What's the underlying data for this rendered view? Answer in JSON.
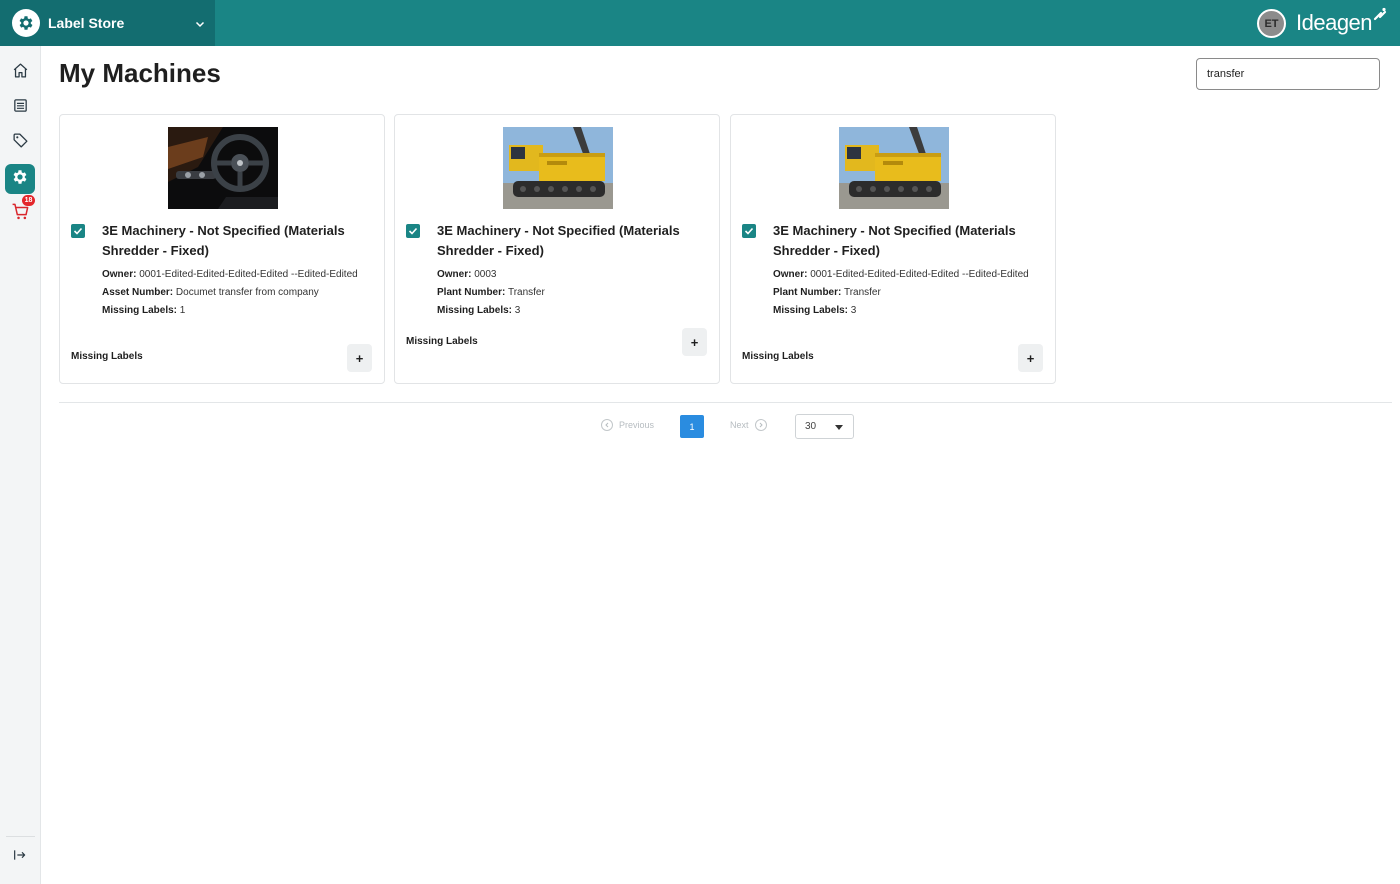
{
  "app": {
    "title": "Label Store",
    "user_initials": "ET",
    "brand": "Ideagen",
    "accent": "#1a8585",
    "header_dark": "#136d70"
  },
  "sidebar": {
    "items": [
      {
        "icon": "home-icon"
      },
      {
        "icon": "list-icon"
      },
      {
        "icon": "tag-icon"
      },
      {
        "icon": "gear-icon",
        "active": true
      },
      {
        "icon": "cart-icon",
        "badge": "18"
      }
    ],
    "footer_icon": "collapse-sidebar-icon"
  },
  "page": {
    "title": "My Machines"
  },
  "search": {
    "value": "transfer"
  },
  "cards": [
    {
      "image": "car-interior-photo",
      "checked": true,
      "title": "3E Machinery - Not Specified (Materials Shredder - Fixed)",
      "details": [
        {
          "key": "Owner:",
          "value": "0001-Edited-Edited-Edited-Edited --Edited-Edited"
        },
        {
          "key": "Asset Number:",
          "value": "Documet transfer from company"
        },
        {
          "key": "Missing Labels:",
          "value": "1"
        }
      ],
      "footer_label": "Missing Labels",
      "add_label": "+"
    },
    {
      "image": "excavator-photo",
      "checked": true,
      "title": "3E Machinery - Not Specified (Materials Shredder - Fixed)",
      "details": [
        {
          "key": "Owner:",
          "value": "0003"
        },
        {
          "key": "Plant Number:",
          "value": "Transfer"
        },
        {
          "key": "Missing Labels:",
          "value": "3"
        }
      ],
      "footer_label": "Missing Labels",
      "add_label": "+"
    },
    {
      "image": "excavator-photo",
      "checked": true,
      "title": "3E Machinery - Not Specified (Materials Shredder - Fixed)",
      "details": [
        {
          "key": "Owner:",
          "value": "0001-Edited-Edited-Edited-Edited --Edited-Edited"
        },
        {
          "key": "Plant Number:",
          "value": "Transfer"
        },
        {
          "key": "Missing Labels:",
          "value": "3"
        }
      ],
      "footer_label": "Missing Labels",
      "add_label": "+"
    }
  ],
  "pagination": {
    "previous": "Previous",
    "next": "Next",
    "current_page": "1",
    "page_size": "30"
  }
}
